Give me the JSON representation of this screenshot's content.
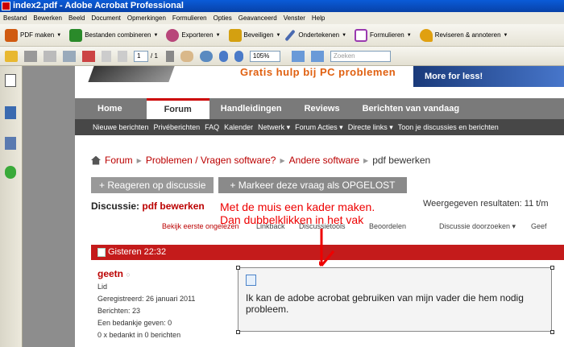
{
  "window": {
    "title": "index2.pdf - Adobe Acrobat Professional"
  },
  "menu": [
    "Bestand",
    "Bewerken",
    "Beeld",
    "Document",
    "Opmerkingen",
    "Formulieren",
    "Opties",
    "Geavanceerd",
    "Venster",
    "Help"
  ],
  "toolbar1": [
    {
      "label": "PDF maken",
      "icon": "create-pdf-icon",
      "color": "#d05a10"
    },
    {
      "label": "Bestanden combineren",
      "icon": "combine-files-icon",
      "color": "#2a8a2a"
    },
    {
      "label": "Exporteren",
      "icon": "export-icon",
      "color": "#b8467a"
    },
    {
      "label": "Beveiligen",
      "icon": "lock-icon",
      "color": "#d4a010"
    },
    {
      "label": "Ondertekenen",
      "icon": "pen-icon",
      "color": "#4a6ab0"
    },
    {
      "label": "Formulieren",
      "icon": "forms-icon",
      "color": "#9a3ab0"
    },
    {
      "label": "Reviseren & annoteren",
      "icon": "review-icon",
      "color": "#e0a010"
    }
  ],
  "toolbar2": {
    "page_current": "1",
    "page_total": "/ 1",
    "zoom": "105%",
    "search_placeholder": "Zoeken"
  },
  "site": {
    "tagline": "Gratis hulp bij PC problemen",
    "banner_right": "More for less!",
    "nav": [
      "Home",
      "Forum",
      "Handleidingen",
      "Reviews",
      "Berichten van vandaag"
    ],
    "subnav": [
      "Nieuwe berichten",
      "Privéberichten",
      "FAQ",
      "Kalender",
      "Netwerk ▾",
      "Forum Acties ▾",
      "Directe links ▾",
      "Toon je discussies en berichten"
    ],
    "breadcrumb": [
      "Forum",
      "Problemen / Vragen software?",
      "Andere software",
      "pdf bewerken"
    ],
    "reply_button": "+ Reageren op discussie",
    "solved_button": "+ Markeer deze vraag als OPGELOST",
    "discussion_label": "Discussie:",
    "discussion_title": "pdf bewerken",
    "results": "Weergegeven resultaten: 11 t/m",
    "tools": [
      "Bekijk eerste ongelezen",
      "Linkback",
      "Discussietools",
      "Beoordelen",
      "Discussie doorzoeken ▾",
      "Geef"
    ],
    "post_time": "Gisteren 22:32",
    "user": {
      "name": "geetn",
      "role": "Lid",
      "registered": "Geregistreerd:   26 januari 2011",
      "posts": "Berichten:     23",
      "thanks_given": "Een bedankje geven:   0",
      "thanked": "0 x bedankt in 0 berichten"
    },
    "post_text_1": "Ik kan de adobe acrobat gebruiken van mijn vader die hem nodig",
    "post_text_2": "probleem."
  },
  "annotation": {
    "line1": "Met de muis een kader maken.",
    "line2": "Dan dubbelklikken in het vak",
    "color": "#e00000"
  }
}
